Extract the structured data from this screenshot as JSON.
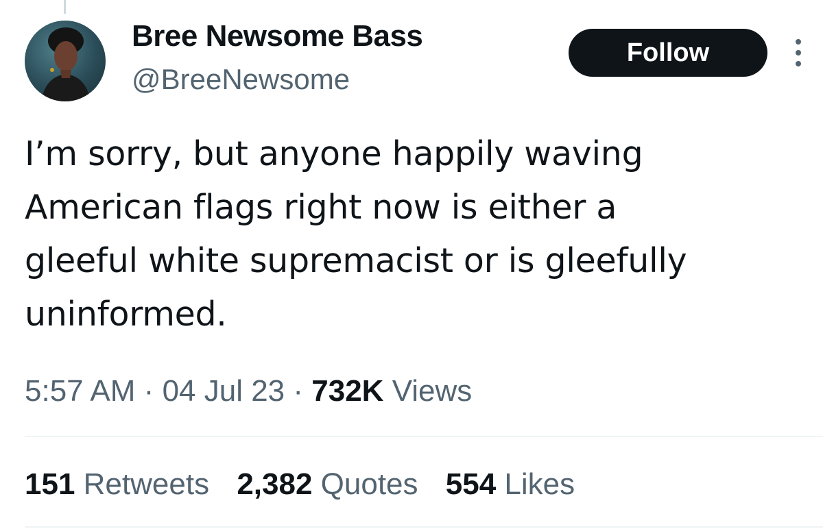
{
  "author": {
    "display_name": "Bree Newsome Bass",
    "handle": "@BreeNewsome"
  },
  "actions": {
    "follow_label": "Follow",
    "more_icon": "more-vertical-icon"
  },
  "tweet": {
    "text": "I’m sorry, but anyone happily waving\nAmerican flags right now is either a\ngleeful white supremacist or is gleefully\nuninformed.",
    "time": "5:57 AM",
    "separator": "·",
    "date": "04 Jul 23",
    "views_count": "732K",
    "views_label": "Views"
  },
  "stats": {
    "retweets_count": "151",
    "retweets_label": "Retweets",
    "quotes_count": "2,382",
    "quotes_label": "Quotes",
    "likes_count": "554",
    "likes_label": "Likes"
  },
  "colors": {
    "primary_text": "#0f1419",
    "secondary_text": "#536471",
    "follow_bg": "#0f1419",
    "divider": "#eff3f4"
  }
}
